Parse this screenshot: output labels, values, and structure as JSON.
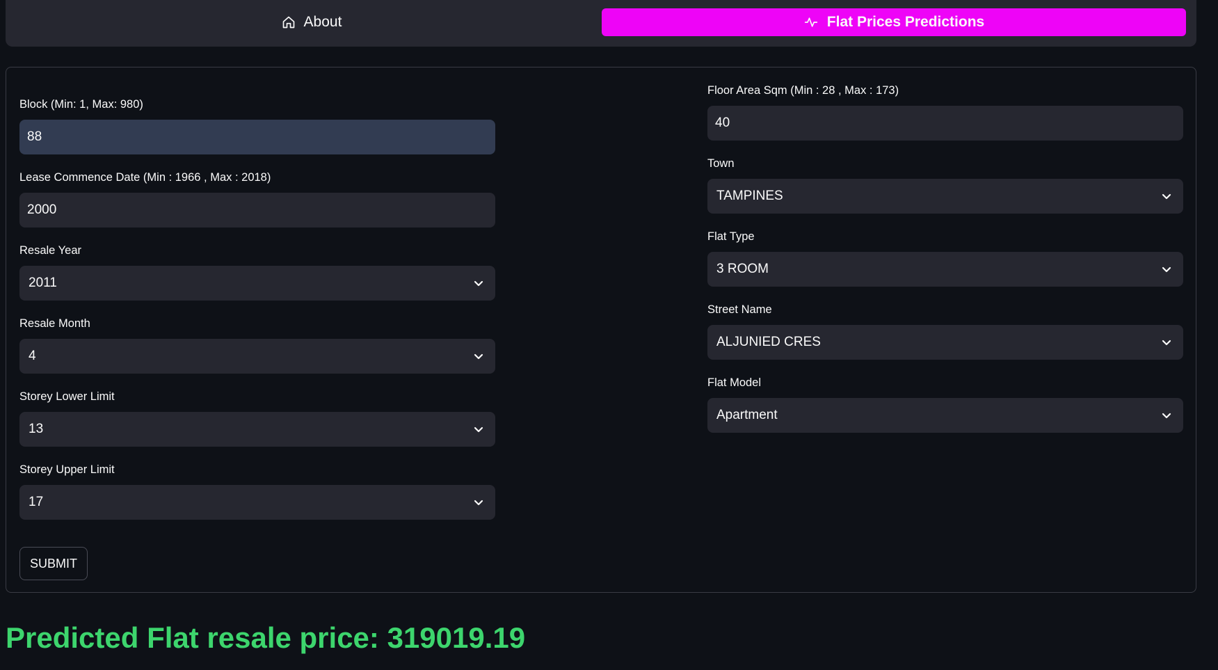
{
  "nav": {
    "tabs": [
      {
        "label": "About",
        "icon": "home-icon",
        "active": false
      },
      {
        "label": "Flat Prices Predictions",
        "icon": "activity-icon",
        "active": true
      }
    ],
    "accent_color": "#ee04f7"
  },
  "form": {
    "block": {
      "label": "Block (Min: 1, Max: 980)",
      "value": "88"
    },
    "lease_commence": {
      "label": "Lease Commence Date (Min : 1966 , Max : 2018)",
      "value": "2000"
    },
    "resale_year": {
      "label": "Resale Year",
      "value": "2011"
    },
    "resale_month": {
      "label": "Resale Month",
      "value": "4"
    },
    "storey_lower": {
      "label": "Storey Lower Limit",
      "value": "13"
    },
    "storey_upper": {
      "label": "Storey Upper Limit",
      "value": "17"
    },
    "floor_area": {
      "label": "Floor Area Sqm (Min : 28 , Max : 173)",
      "value": "40"
    },
    "town": {
      "label": "Town",
      "value": "TAMPINES"
    },
    "flat_type": {
      "label": "Flat Type",
      "value": "3 ROOM"
    },
    "street_name": {
      "label": "Street Name",
      "value": "ALJUNIED CRES"
    },
    "flat_model": {
      "label": "Flat Model",
      "value": "Apartment"
    },
    "submit_label": "SUBMIT"
  },
  "result": {
    "text": "Predicted Flat resale price: 319019.19",
    "color": "#3dd56d"
  }
}
